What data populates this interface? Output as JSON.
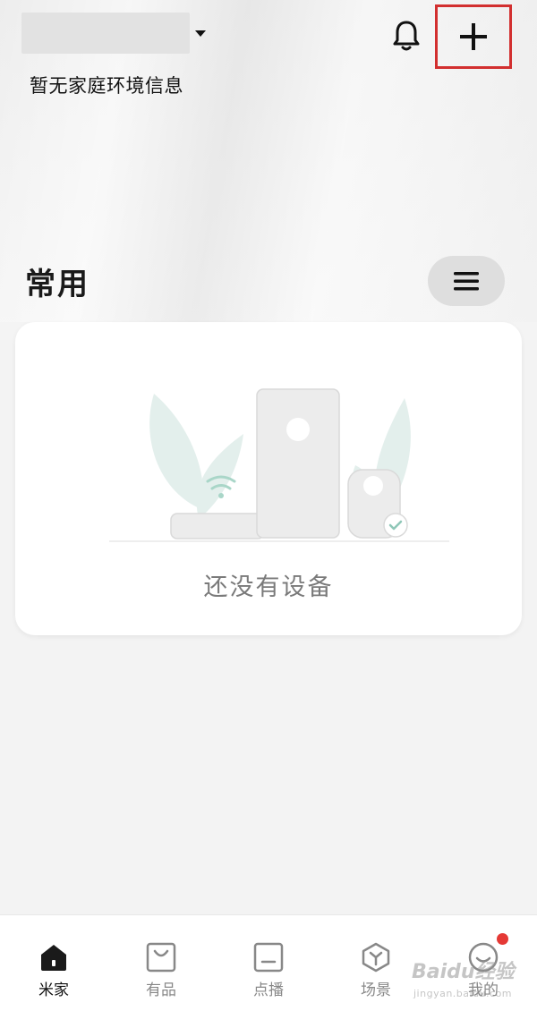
{
  "header": {
    "home_name": "",
    "env_info": "暂无家庭环境信息",
    "icons": {
      "dropdown": "caret-down-icon",
      "notifications": "bell-icon",
      "add": "plus-icon"
    }
  },
  "favorites": {
    "title": "常用",
    "menu_icon": "menu-icon"
  },
  "empty_state": {
    "message": "还没有设备"
  },
  "bottom_nav": {
    "items": [
      {
        "label": "米家",
        "icon": "home-icon",
        "active": true
      },
      {
        "label": "有品",
        "icon": "shopping-bag-icon",
        "active": false
      },
      {
        "label": "点播",
        "icon": "media-icon",
        "active": false
      },
      {
        "label": "场景",
        "icon": "scene-icon",
        "active": false
      },
      {
        "label": "我的",
        "icon": "profile-icon",
        "active": false,
        "has_notification": true
      }
    ]
  },
  "watermark": {
    "text": "Baidu经验",
    "sub": "jingyan.baidu.com"
  },
  "colors": {
    "highlight": "#d22f2f",
    "notice_dot": "#e53935",
    "accent_icon": "#8fc7b8"
  }
}
